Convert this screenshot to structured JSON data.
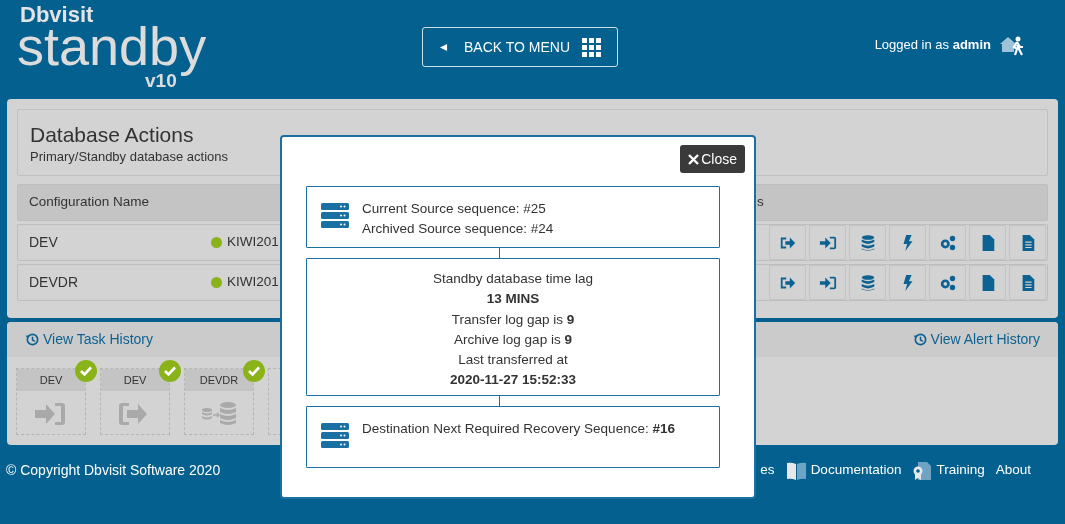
{
  "header": {
    "brand": "Dbvisit",
    "product": "standby",
    "version": "v10",
    "back_button": "BACK TO MENU",
    "login_prefix": "Logged in as",
    "user": "admin"
  },
  "panel": {
    "title": "Database Actions",
    "subtitle": "Primary/Standby database actions",
    "columns": [
      "Configuration Name",
      "s"
    ],
    "rows": [
      {
        "name": "DEV",
        "host": "KIWI201",
        "color": "#8ab31a"
      },
      {
        "name": "DEVDR",
        "host": "KIWI201",
        "color": "#8ab31a"
      }
    ]
  },
  "history": {
    "task_link": "View Task History",
    "alert_link": "View Alert History",
    "tasks": [
      {
        "name": "DEV",
        "kind": "login",
        "done": true
      },
      {
        "name": "DEV",
        "kind": "logout",
        "done": true
      },
      {
        "name": "DEVDR",
        "kind": "transfer",
        "done": true
      }
    ]
  },
  "footer": {
    "copyright": "© Copyright Dbvisit Software 2020",
    "links": [
      {
        "label": "es",
        "kind": "plain"
      },
      {
        "label": "Documentation",
        "kind": "book"
      },
      {
        "label": "Training",
        "kind": "award"
      },
      {
        "label": "About",
        "kind": "plain"
      }
    ]
  },
  "modal": {
    "close": "Close",
    "boxes": [
      {
        "kind": "server",
        "lines": [
          {
            "text": "Current Source sequence: #25",
            "emphasis": false
          },
          {
            "text": "Archived Source sequence: #24",
            "emphasis": false
          }
        ]
      },
      {
        "kind": "centered",
        "lines": [
          {
            "text": "Standby database time lag",
            "emphasis": false
          },
          {
            "text": "13 MINS",
            "emphasis": true
          },
          {
            "text": "Transfer log gap is **9**",
            "emphasis": false
          },
          {
            "text": "Archive log gap is **9**",
            "emphasis": false
          },
          {
            "text": "Last transferred at",
            "emphasis": false
          },
          {
            "text": "2020-11-27 15:52:33",
            "emphasis": true
          }
        ]
      },
      {
        "kind": "server",
        "lines": [
          {
            "text": "Destination Next Required Recovery Sequence: **#16**",
            "emphasis": false
          }
        ]
      }
    ]
  }
}
